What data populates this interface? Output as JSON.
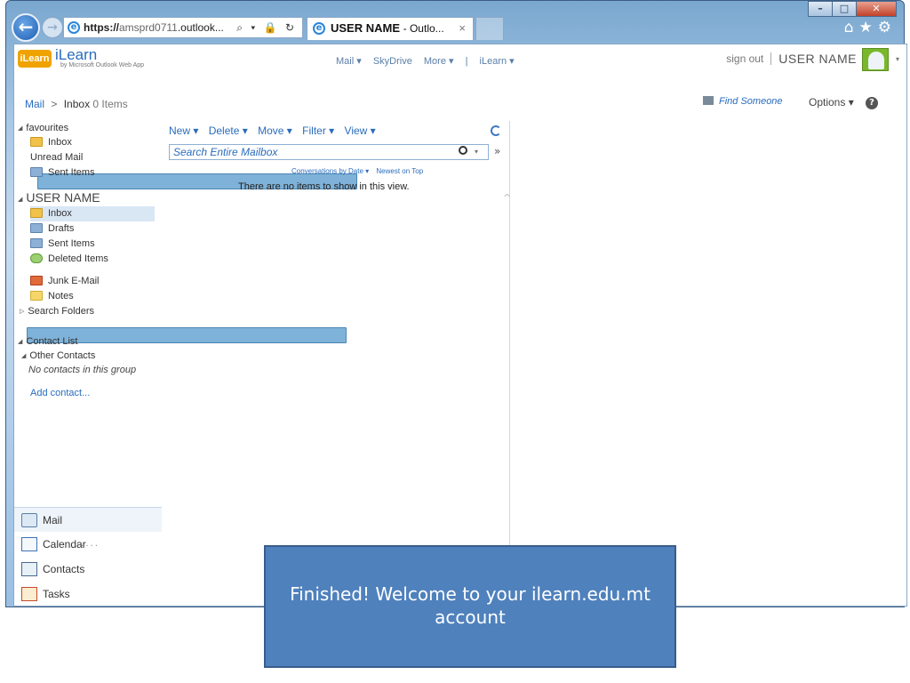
{
  "browser": {
    "address_url_bold": "https://",
    "address_url_gray": "amsprd0711",
    "address_url_rest": ".outlook...",
    "address_tools": "⌕ ▾ 🔒 ↻",
    "tab_title_bold": "USER NAME",
    "tab_title_rest": "- Outlo...",
    "tab_close": "×"
  },
  "header": {
    "logo_text": "iLearn",
    "app_title": "iLearn",
    "app_subtitle": "by Microsoft Outlook Web App",
    "topnav": [
      "Mail ▾",
      "SkyDrive",
      "More ▾",
      "|",
      "iLearn ▾"
    ],
    "sign_out": "sign out",
    "username": "USER NAME"
  },
  "breadcrumb": {
    "mail": "Mail",
    "sep": ">",
    "inbox": "Inbox",
    "count": "0 Items"
  },
  "utility": {
    "find_someone": "Find Someone",
    "options": "Options ▾"
  },
  "nav": {
    "favourites_label": "favourites",
    "favourites": [
      "Inbox",
      "Unread Mail",
      "Sent Items"
    ],
    "user_label": "USER NAME",
    "folders": [
      "Inbox",
      "Drafts",
      "Sent Items",
      "Deleted Items",
      "Junk E-Mail",
      "Notes",
      "Search Folders"
    ],
    "contact_list_label": "Contact List",
    "other_contacts_label": "Other Contacts",
    "no_contacts": "No contacts in this group",
    "add_contact": "Add contact...",
    "more_dots": "....."
  },
  "bottom_nav": [
    "Mail",
    "Calendar",
    "Contacts",
    "Tasks"
  ],
  "pane": {
    "actions": [
      "New ▾",
      "Delete ▾",
      "Move ▾",
      "Filter ▾",
      "View ▾"
    ],
    "search_placeholder": "Search Entire Mailbox",
    "sort_by": "Conversations by Date ▾",
    "sort_order": "Newest on Top",
    "empty_message": "There are no items to show in this view."
  },
  "callout": {
    "text": "Finished! Welcome to your ilearn.edu.mt account"
  }
}
